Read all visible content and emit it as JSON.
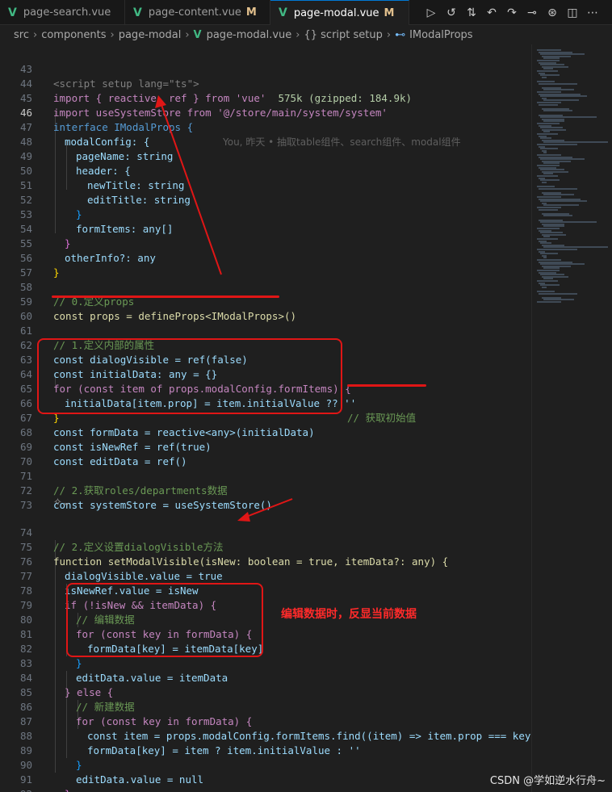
{
  "tabs": [
    {
      "label": "page-search.vue",
      "icon": "vue-icon",
      "modified": "",
      "active": false
    },
    {
      "label": "page-content.vue",
      "icon": "vue-icon",
      "modified": "M",
      "active": false
    },
    {
      "label": "page-modal.vue",
      "icon": "vue-icon",
      "modified": "M",
      "active": true
    }
  ],
  "toolbar_icons": [
    "run-icon",
    "history-icon",
    "compare-changes-icon",
    "go-back-icon",
    "go-forward-icon",
    "commit-icon",
    "git-lens-icon",
    "split-editor-icon",
    "more-actions-icon"
  ],
  "breadcrumb": {
    "parts": [
      "src",
      "components",
      "page-modal"
    ],
    "file": "page-modal.vue",
    "section": "{} script setup",
    "symbol": "IModalProps"
  },
  "gutter": {
    "numbers": [
      "43",
      "44",
      "45",
      "46",
      "47",
      "48",
      "49",
      "50",
      "51",
      "52",
      "53",
      "54",
      "55",
      "56",
      "57",
      "58",
      "59",
      "60",
      "61",
      "62",
      "63",
      "64",
      "65",
      "66",
      "67",
      "68",
      "69",
      "70",
      "71",
      "72",
      "73",
      "74",
      "75",
      "76",
      "77",
      "78",
      "79",
      "80",
      "81",
      "82",
      "83",
      "84",
      "85",
      "86",
      "87",
      "88",
      "89",
      "90",
      "91",
      "92"
    ],
    "current": "46"
  },
  "code": {
    "l43_script": "<script setup lang=\"ts\">",
    "l44_import": "import { reactive, ref } from 'vue'",
    "l44_size": "575k (gzipped: 184.9k)",
    "l45": "import useSystemStore from '@/store/main/system/system'",
    "l46": "interface IModalProps {",
    "l46_blame": "You, 昨天 • 抽取table组件、search组件、modal组件",
    "l47": "modalConfig: {",
    "l48": "pageName: string",
    "l49": "header: {",
    "l50": "newTitle: string",
    "l51": "editTitle: string",
    "l52": "}",
    "l53": "formItems: any[]",
    "l54": "}",
    "l55": "otherInfo?: any",
    "l56": "}",
    "l58": "// 0.定义props",
    "l59": "const props = defineProps<IModalProps>()",
    "l61": "// 1.定义内部的属性",
    "l62": "const dialogVisible = ref(false)",
    "l63": "const initialData: any = {}",
    "l64": "for (const item of props.modalConfig.formItems) {",
    "l65": "initialData[item.prop] = item.initialValue ?? ''",
    "l65_comment": "// 获取初始值",
    "l66": "}",
    "l67": "const formData = reactive<any>(initialData)",
    "l68": "const isNewRef = ref(true)",
    "l69": "const editData = ref()",
    "l71": "// 2.获取roles/departments数据",
    "l72": "const systemStore = useSystemStore()",
    "l74": "// 2.定义设置dialogVisible方法",
    "l75": "function setModalVisible(isNew: boolean = true, itemData?: any) {",
    "l76": "dialogVisible.value = true",
    "l77": "isNewRef.value = isNew",
    "l78": "if (!isNew && itemData) {",
    "l79": "// 编辑数据",
    "l80": "for (const key in formData) {",
    "l81": "formData[key] = itemData[key]",
    "l82": "}",
    "l83": "editData.value = itemData",
    "l84": "} else {",
    "l85": "// 新建数据",
    "l86": "for (const key in formData) {",
    "l87": "const item = props.modalConfig.formItems.find((item) => item.prop === key)",
    "l88": "formData[key] = item ? item.initialValue : ''",
    "l89": "}",
    "l90": "editData.value = null",
    "l91": "}",
    "l92": "}"
  },
  "annotations": {
    "note_edit": "编辑数据时，反显当前数据",
    "watermark": "CSDN @学如逆水行舟~"
  },
  "colors": {
    "annotation_red": "#e01616",
    "vue_green": "#41b883",
    "background": "#1f1f1f"
  }
}
